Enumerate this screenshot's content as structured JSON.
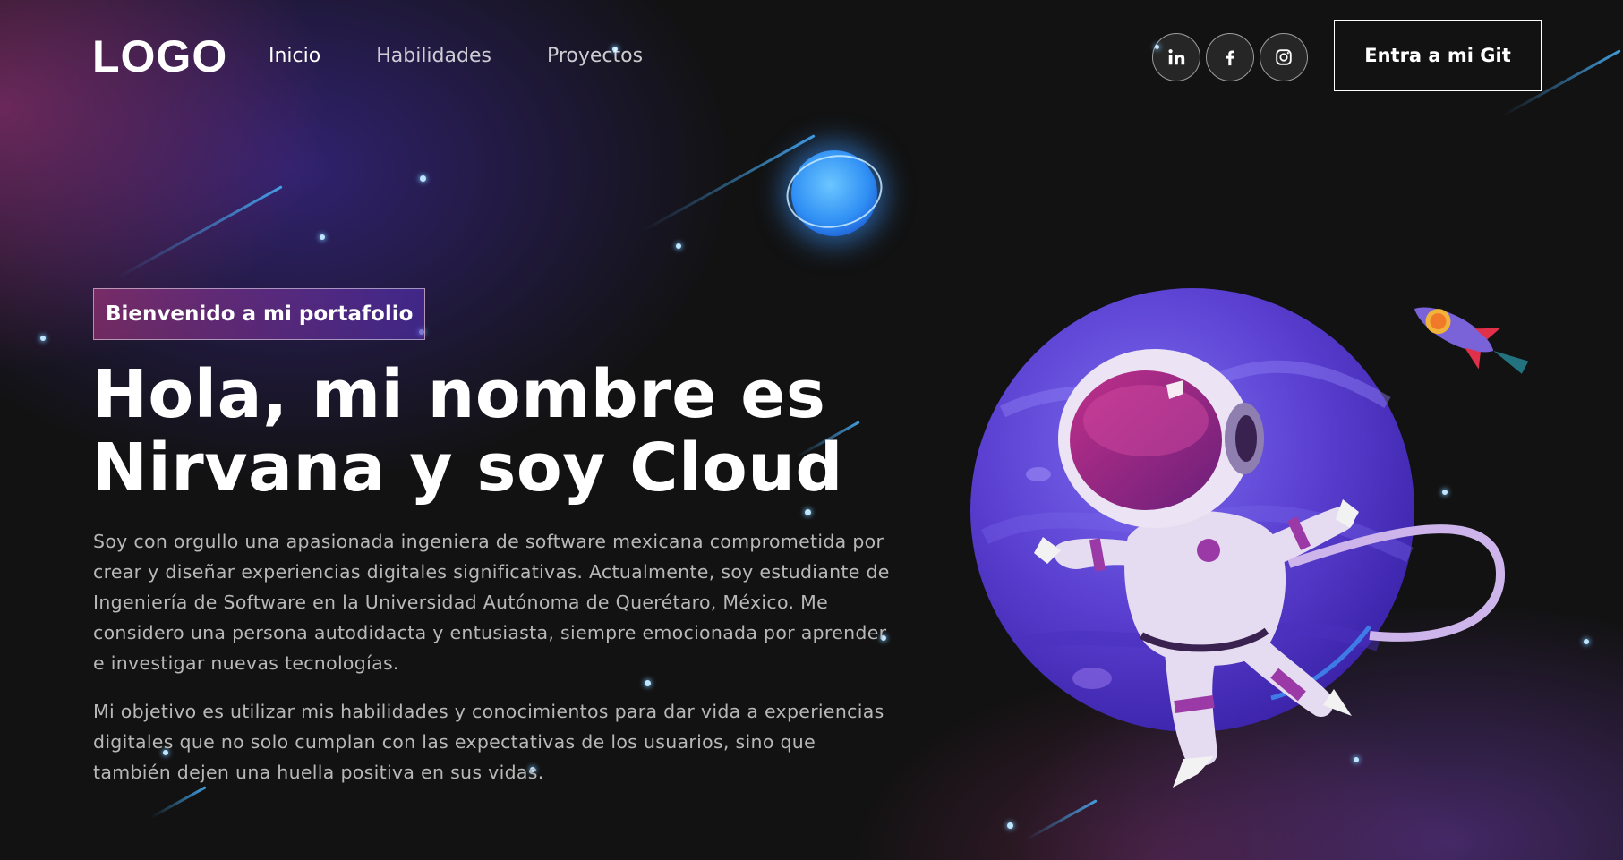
{
  "nav": {
    "logo": "LOGO",
    "links": [
      {
        "label": "Inicio",
        "active": true
      },
      {
        "label": "Habilidades",
        "active": false
      },
      {
        "label": "Proyectos",
        "active": false
      }
    ],
    "social": [
      {
        "name": "linkedin-icon"
      },
      {
        "name": "facebook-icon"
      },
      {
        "name": "instagram-icon"
      }
    ],
    "cta_label": "Entra a mi Git"
  },
  "hero": {
    "tagline": "Bienvenido a mi portafolio",
    "title_line1": "Hola, mi nombre es",
    "title_line2": "Nirvana y soy Cloud",
    "paragraph1": "Soy con orgullo una apasionada ingeniera de software mexicana comprometida por crear y diseñar experiencias digitales significativas. Actualmente, soy estudiante de Ingeniería de Software en la Universidad Autónoma de Querétaro, México. Me considero una persona autodidacta y entusiasta, siempre emocionada por aprender e investigar nuevas tecnologías.",
    "paragraph2": "Mi objetivo es utilizar mis habilidades y conocimientos para dar vida a experiencias digitales que no solo cumplan con las expectativas de los usuarios, sino que también dejen una huella positiva en sus vidas."
  },
  "illustrations": {
    "planet": "purple-planet-illustration",
    "astronaut": "astronaut-illustration",
    "rocket": "rocket-illustration",
    "small_planet": "blue-planet-illustration"
  },
  "colors": {
    "background": "#121212",
    "accent_pink": "#AA367C",
    "accent_purple": "#4A2FBD",
    "text_muted": "#B8B8B8"
  }
}
